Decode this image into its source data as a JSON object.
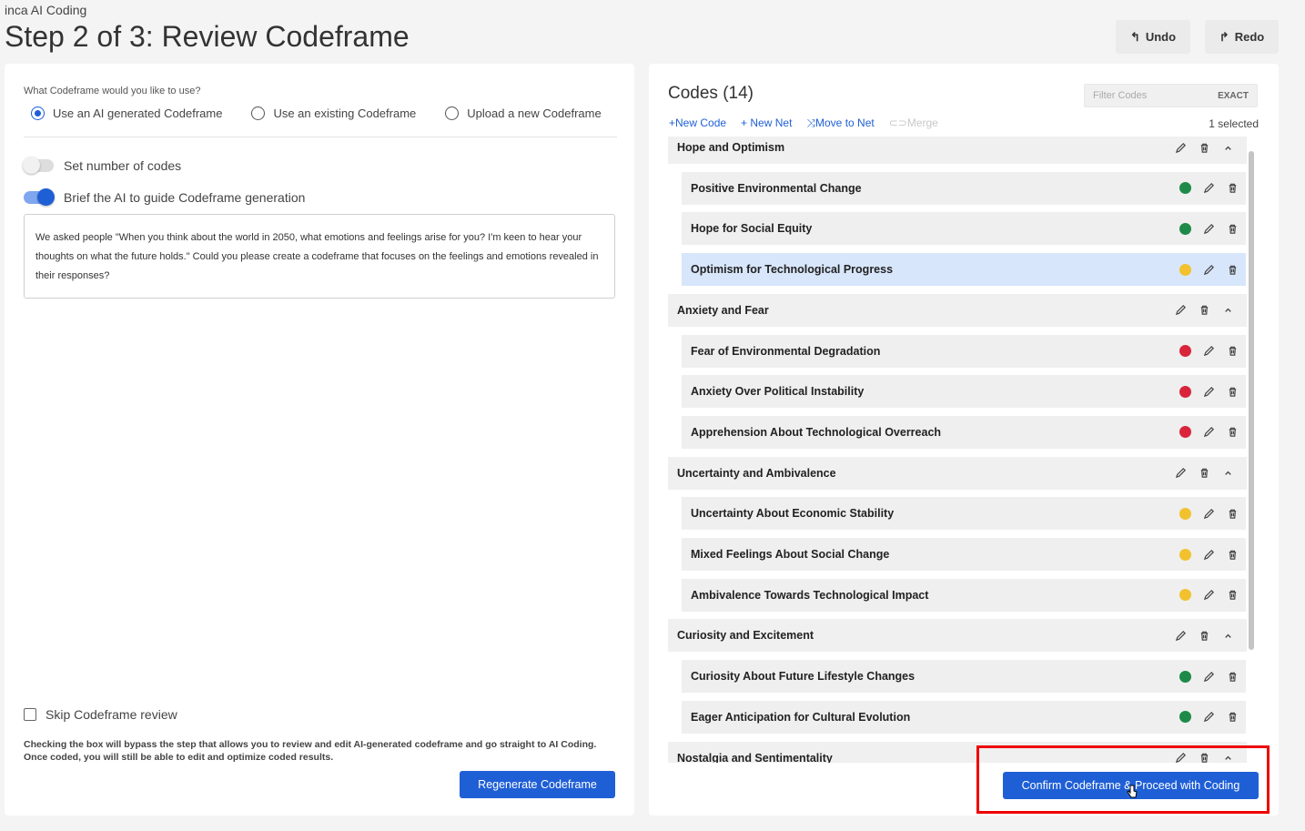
{
  "header": {
    "app_name": "inca AI Coding",
    "title": "Step 2 of 3: Review Codeframe",
    "undo_label": "Undo",
    "redo_label": "Redo"
  },
  "left": {
    "question": "What Codeframe would you like to use?",
    "options": [
      {
        "label": "Use an AI generated Codeframe",
        "checked": true
      },
      {
        "label": "Use an existing Codeframe",
        "checked": false
      },
      {
        "label": "Upload a new Codeframe",
        "checked": false
      }
    ],
    "set_number_label": "Set number of codes",
    "set_number_on": false,
    "brief_label": "Brief the AI to guide Codeframe generation",
    "brief_on": true,
    "brief_text": "We asked people \"When you think about the world in 2050, what emotions and feelings arise for you? I'm keen to hear your thoughts on what the future holds.\" Could you please create a codeframe that focuses on the feelings and emotions revealed in their responses?",
    "skip_label": "Skip Codeframe review",
    "skip_help": "Checking the box will bypass the step that allows you to review and edit AI-generated codeframe and go straight to AI Coding. Once coded, you will still be able to edit and optimize coded results.",
    "regenerate_label": "Regenerate Codeframe"
  },
  "right": {
    "codes_title": "Codes (14)",
    "filter_placeholder": "Filter Codes",
    "filter_mode": "EXACT",
    "actions": {
      "new_code": "+New Code",
      "new_net": "+ New Net",
      "move_to_net": "Move to Net",
      "merge": "Merge"
    },
    "selected_count": "1 selected",
    "confirm_label": "Confirm Codeframe & Proceed with Coding"
  },
  "colors": {
    "green": "#1e8a4a",
    "yellow": "#f2c12e",
    "red": "#d9253b",
    "accent": "#1f5fd6"
  },
  "groups": [
    {
      "name": "Hope and Optimism",
      "codes": [
        {
          "name": "Positive Environmental Change",
          "color": "green"
        },
        {
          "name": "Hope for Social Equity",
          "color": "green"
        },
        {
          "name": "Optimism for Technological Progress",
          "color": "yellow",
          "selected": true
        }
      ]
    },
    {
      "name": "Anxiety and Fear",
      "codes": [
        {
          "name": "Fear of Environmental Degradation",
          "color": "red"
        },
        {
          "name": "Anxiety Over Political Instability",
          "color": "red"
        },
        {
          "name": "Apprehension About Technological Overreach",
          "color": "red"
        }
      ]
    },
    {
      "name": "Uncertainty and Ambivalence",
      "codes": [
        {
          "name": "Uncertainty About Economic Stability",
          "color": "yellow"
        },
        {
          "name": "Mixed Feelings About Social Change",
          "color": "yellow"
        },
        {
          "name": "Ambivalence Towards Technological Impact",
          "color": "yellow"
        }
      ]
    },
    {
      "name": "Curiosity and Excitement",
      "codes": [
        {
          "name": "Curiosity About Future Lifestyle Changes",
          "color": "green"
        },
        {
          "name": "Eager Anticipation for Cultural Evolution",
          "color": "green"
        }
      ]
    },
    {
      "name": "Nostalgia and Sentimentality",
      "codes": []
    }
  ]
}
